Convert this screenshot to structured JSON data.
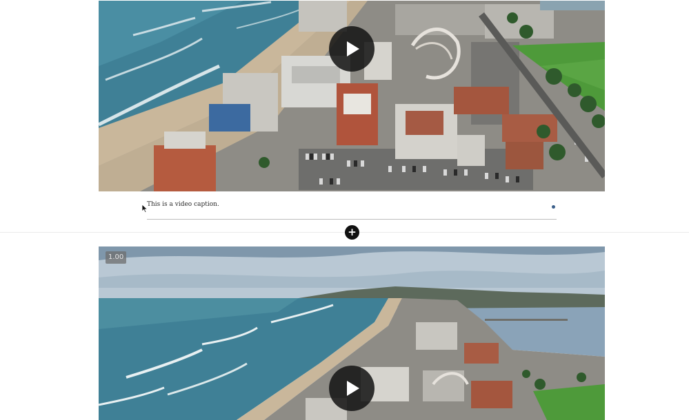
{
  "video_top": {
    "caption": "This is a video caption.",
    "play_icon": "play-icon"
  },
  "video_bottom": {
    "speed_label": "1.00",
    "play_icon": "play-icon"
  },
  "add_block": {
    "label": "+",
    "icon": "plus-icon"
  },
  "cursor_icon": "arrow-cursor-icon",
  "colors": {
    "ocean": "#3f8096",
    "sand": "#c7b59b",
    "grass": "#4e9a3a",
    "sky": "#b9c8d4",
    "button": "#111111",
    "caption_dot": "#3b5f8a"
  }
}
